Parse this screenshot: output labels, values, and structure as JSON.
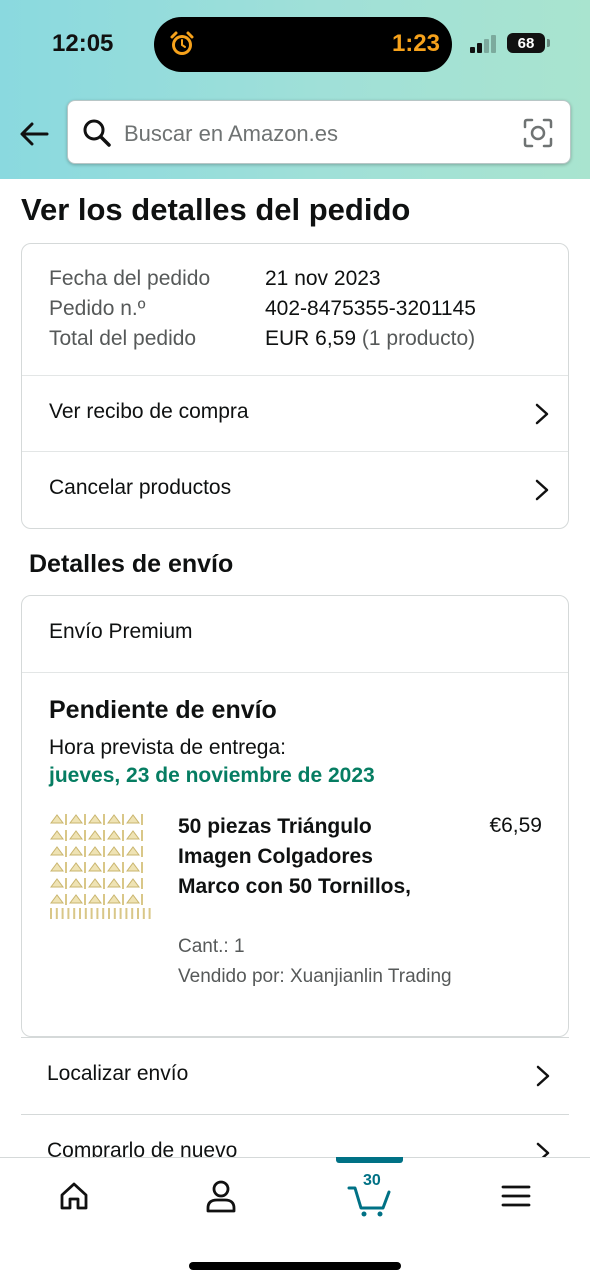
{
  "status_bar": {
    "time": "12:05",
    "timer": "1:23",
    "battery": "68"
  },
  "header": {
    "search_placeholder": "Buscar en Amazon.es"
  },
  "page": {
    "title": "Ver los detalles del pedido"
  },
  "order_summary": {
    "rows": [
      {
        "label": "Fecha del pedido",
        "value": "21 nov 2023",
        "extra": ""
      },
      {
        "label": "Pedido n.º",
        "value": "402-8475355-3201145",
        "extra": ""
      },
      {
        "label": "Total del pedido",
        "value": "EUR 6,59",
        "extra": "(1 producto)"
      }
    ],
    "links": [
      {
        "label": "Ver recibo de compra"
      },
      {
        "label": "Cancelar productos"
      }
    ]
  },
  "shipping": {
    "section_title": "Detalles de envío",
    "type": "Envío Premium",
    "status": "Pendiente de envío",
    "eta_label": "Hora prevista de entrega:",
    "eta_date": "jueves, 23 de noviembre de 2023",
    "product": {
      "title": "50 piezas Triángulo Imagen Colgadores Marco con 50 Tornillos,",
      "price": "€6,59",
      "quantity": "Cant.: 1",
      "seller": "Vendido por: Xuanjianlin Trading"
    }
  },
  "actions": [
    {
      "label": "Localizar envío"
    },
    {
      "label": "Comprarlo de nuevo"
    }
  ],
  "tabbar": {
    "cart_count": "30",
    "active_color": "#007185"
  }
}
